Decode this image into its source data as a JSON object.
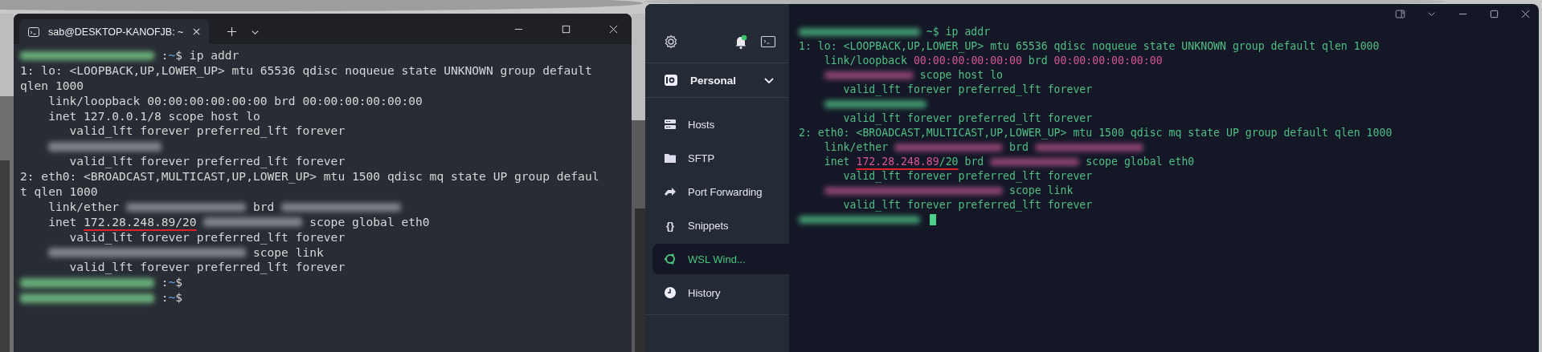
{
  "windows_terminal": {
    "tab": {
      "title": "sab@DESKTOP-KANOFJB: ~",
      "selected": true
    },
    "lines": [
      [
        {
          "kind": "redacted_user"
        },
        {
          "kind": "plain",
          "text": ":"
        },
        {
          "kind": "path",
          "text": "~"
        },
        {
          "kind": "plain",
          "text": "$ ip addr"
        }
      ],
      [
        {
          "kind": "plain",
          "text": "1: lo: <LOOPBACK,UP,LOWER_UP> mtu 65536 qdisc noqueue state UNKNOWN group default"
        }
      ],
      [
        {
          "kind": "plain",
          "text": "qlen 1000"
        }
      ],
      [
        {
          "kind": "plain",
          "text": "    link/loopback 00:00:00:00:00:00 brd 00:00:00:00:00:00"
        }
      ],
      [
        {
          "kind": "plain",
          "text": "    inet 127.0.0.1/8 scope host lo"
        }
      ],
      [
        {
          "kind": "plain",
          "text": "       valid_lft forever preferred_lft forever"
        }
      ],
      [
        {
          "kind": "redacted_short",
          "indented": true
        }
      ],
      [
        {
          "kind": "plain",
          "text": "       valid_lft forever preferred_lft forever"
        }
      ],
      [
        {
          "kind": "plain",
          "text": "2: eth0: <BROADCAST,MULTICAST,UP,LOWER_UP> mtu 1500 qdisc mq state UP group defaul"
        }
      ],
      [
        {
          "kind": "plain",
          "text": "t qlen 1000"
        }
      ],
      [
        {
          "kind": "plain",
          "text": "    link/ether"
        },
        {
          "kind": "redacted_mac"
        },
        {
          "kind": "plain",
          "text": "brd"
        },
        {
          "kind": "redacted_mac"
        }
      ],
      [
        {
          "kind": "plain",
          "text": "    inet "
        },
        {
          "kind": "plain",
          "text": "172.28.248.89/20",
          "underlined": true
        },
        {
          "kind": "redacted_ip"
        },
        {
          "kind": "plain",
          "text": "scope global eth0"
        }
      ],
      [
        {
          "kind": "plain",
          "text": "       valid_lft forever preferred_lft forever"
        }
      ],
      [
        {
          "kind": "redacted_ip6",
          "indented": true
        },
        {
          "kind": "plain",
          "text": "scope link"
        }
      ],
      [
        {
          "kind": "plain",
          "text": "       valid_lft forever preferred_lft forever"
        }
      ],
      [
        {
          "kind": "redacted_user"
        },
        {
          "kind": "plain",
          "text": ":"
        },
        {
          "kind": "path",
          "text": "~"
        },
        {
          "kind": "plain",
          "text": "$"
        }
      ],
      [
        {
          "kind": "redacted_user"
        },
        {
          "kind": "plain",
          "text": ":"
        },
        {
          "kind": "path",
          "text": "~"
        },
        {
          "kind": "plain",
          "text": "$"
        }
      ]
    ]
  },
  "termius": {
    "vault": {
      "label": "Personal"
    },
    "sidebar": {
      "items": [
        {
          "kind": "hosts",
          "label": "Hosts",
          "selected": false
        },
        {
          "kind": "sftp",
          "label": "SFTP",
          "selected": false
        },
        {
          "kind": "port",
          "label": "Port Forwarding",
          "selected": false
        },
        {
          "kind": "snippets",
          "glyph": "{}",
          "label": "Snippets",
          "selected": false
        },
        {
          "kind": "wsl",
          "label": "WSL Wind...",
          "selected": true
        },
        {
          "kind": "history",
          "label": "History",
          "selected": false
        }
      ]
    },
    "lines": [
      [
        {
          "kind": "redacted_user"
        },
        {
          "kind": "plain",
          "text": "~$ ip addr"
        }
      ],
      [
        {
          "kind": "plain",
          "text": "1: lo: <LOOPBACK,UP,LOWER_UP> mtu 65536 qdisc noqueue state UNKNOWN group default qlen 1000"
        }
      ],
      [
        {
          "kind": "plain",
          "text": "    link/loopback "
        },
        {
          "kind": "addr",
          "text": "00:00:00:00:00:00"
        },
        {
          "kind": "plain",
          "text": " brd "
        },
        {
          "kind": "addr",
          "text": "00:00:00:00:00:00"
        }
      ],
      [
        {
          "kind": "redacted_ip",
          "indented": true
        },
        {
          "kind": "plain",
          "text": "scope host lo"
        }
      ],
      [
        {
          "kind": "plain",
          "text": "       valid_lft forever preferred_lft forever"
        }
      ],
      [
        {
          "kind": "redacted_short",
          "indented": true
        }
      ],
      [
        {
          "kind": "plain",
          "text": "       valid_lft forever preferred_lft forever"
        }
      ],
      [
        {
          "kind": "plain",
          "text": "2: eth0: <BROADCAST,MULTICAST,UP,LOWER_UP> mtu 1500 qdisc mq state UP group default qlen 1000"
        }
      ],
      [
        {
          "kind": "plain",
          "text": "    link/ether"
        },
        {
          "kind": "redacted_mac"
        },
        {
          "kind": "plain",
          "text": "brd"
        },
        {
          "kind": "redacted_mac"
        }
      ],
      [
        {
          "kind": "plain",
          "text": "    inet "
        },
        {
          "kind": "addr",
          "text": "172.28.248.89",
          "underlined": true
        },
        {
          "kind": "plain",
          "text": "/20",
          "underlined": true
        },
        {
          "kind": "plain",
          "text": " brd"
        },
        {
          "kind": "redacted_ip"
        },
        {
          "kind": "plain",
          "text": "scope global eth0"
        }
      ],
      [
        {
          "kind": "plain",
          "text": "       valid_lft forever preferred_lft forever"
        }
      ],
      [
        {
          "kind": "redacted_ip6",
          "indented": true
        },
        {
          "kind": "plain",
          "text": "scope link"
        }
      ],
      [
        {
          "kind": "plain",
          "text": "       valid_lft forever preferred_lft forever"
        }
      ],
      [
        {
          "kind": "redacted_user"
        },
        {
          "kind": "cursor"
        }
      ]
    ]
  }
}
